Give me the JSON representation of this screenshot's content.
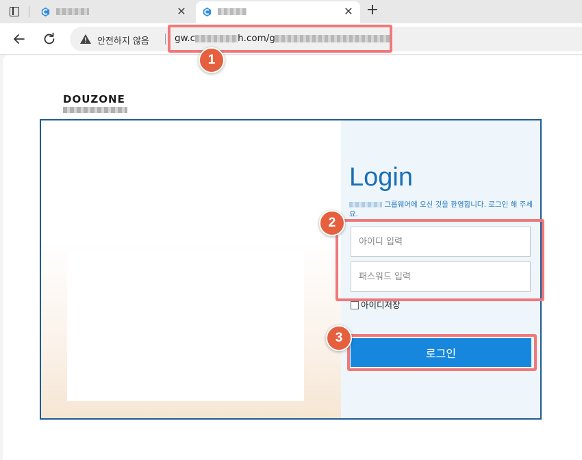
{
  "browser": {
    "tabs": [
      {
        "title": "",
        "active": false
      },
      {
        "title": "",
        "active": true
      }
    ],
    "security_label": "안전하지 않음",
    "url_prefix": "gw.c",
    "url_mid": "h.com/g",
    "new_tab_symbol": "+",
    "close_symbol": "✕"
  },
  "page": {
    "logo_text": "DOUZONE",
    "login_title": "Login",
    "welcome_text": "그룹웨어에 오신 것을 환영합니다. 로그인 해 주세요.",
    "id_placeholder": "아이디 입력",
    "pw_placeholder": "패스워드 입력",
    "remember_label": "아이디저장",
    "login_button": "로그인"
  },
  "annotations": {
    "badges": [
      "1",
      "2",
      "3"
    ],
    "highlight_color": "#f0787a",
    "badge_color": "#e4603e"
  },
  "colors": {
    "accent": "#1787de",
    "title": "#1a6fb5",
    "box_border": "#1e5b94"
  },
  "icons": [
    "sidebar-icon",
    "tab-favicon",
    "close-icon",
    "plus-icon",
    "back-arrow-icon",
    "reload-icon",
    "warning-icon"
  ]
}
